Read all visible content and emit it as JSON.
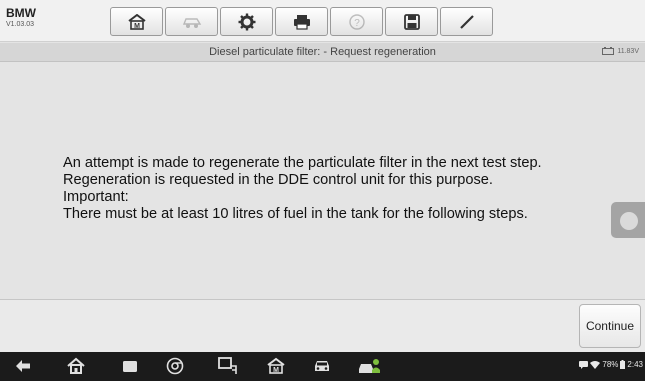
{
  "app": {
    "name": "BMW",
    "version": "V1.03.03"
  },
  "toolbar": {
    "tools": [
      "home-icon",
      "vehicle-swap-icon",
      "settings-icon",
      "print-icon",
      "help-icon",
      "save-icon",
      "edit-icon"
    ]
  },
  "header": {
    "title": "Diesel particulate filter: - Request regeneration",
    "voltage": "11.83V"
  },
  "message": {
    "lines": [
      "An attempt is made to regenerate the particulate filter in the next test step.",
      "Regeneration is requested in the DDE control unit for this purpose.",
      "Important:",
      "There must be at least 10 litres of fuel in the tank for the following steps."
    ]
  },
  "footer": {
    "continue_label": "Continue"
  },
  "statusbar": {
    "battery_percent": "78%",
    "time": "2:43"
  }
}
